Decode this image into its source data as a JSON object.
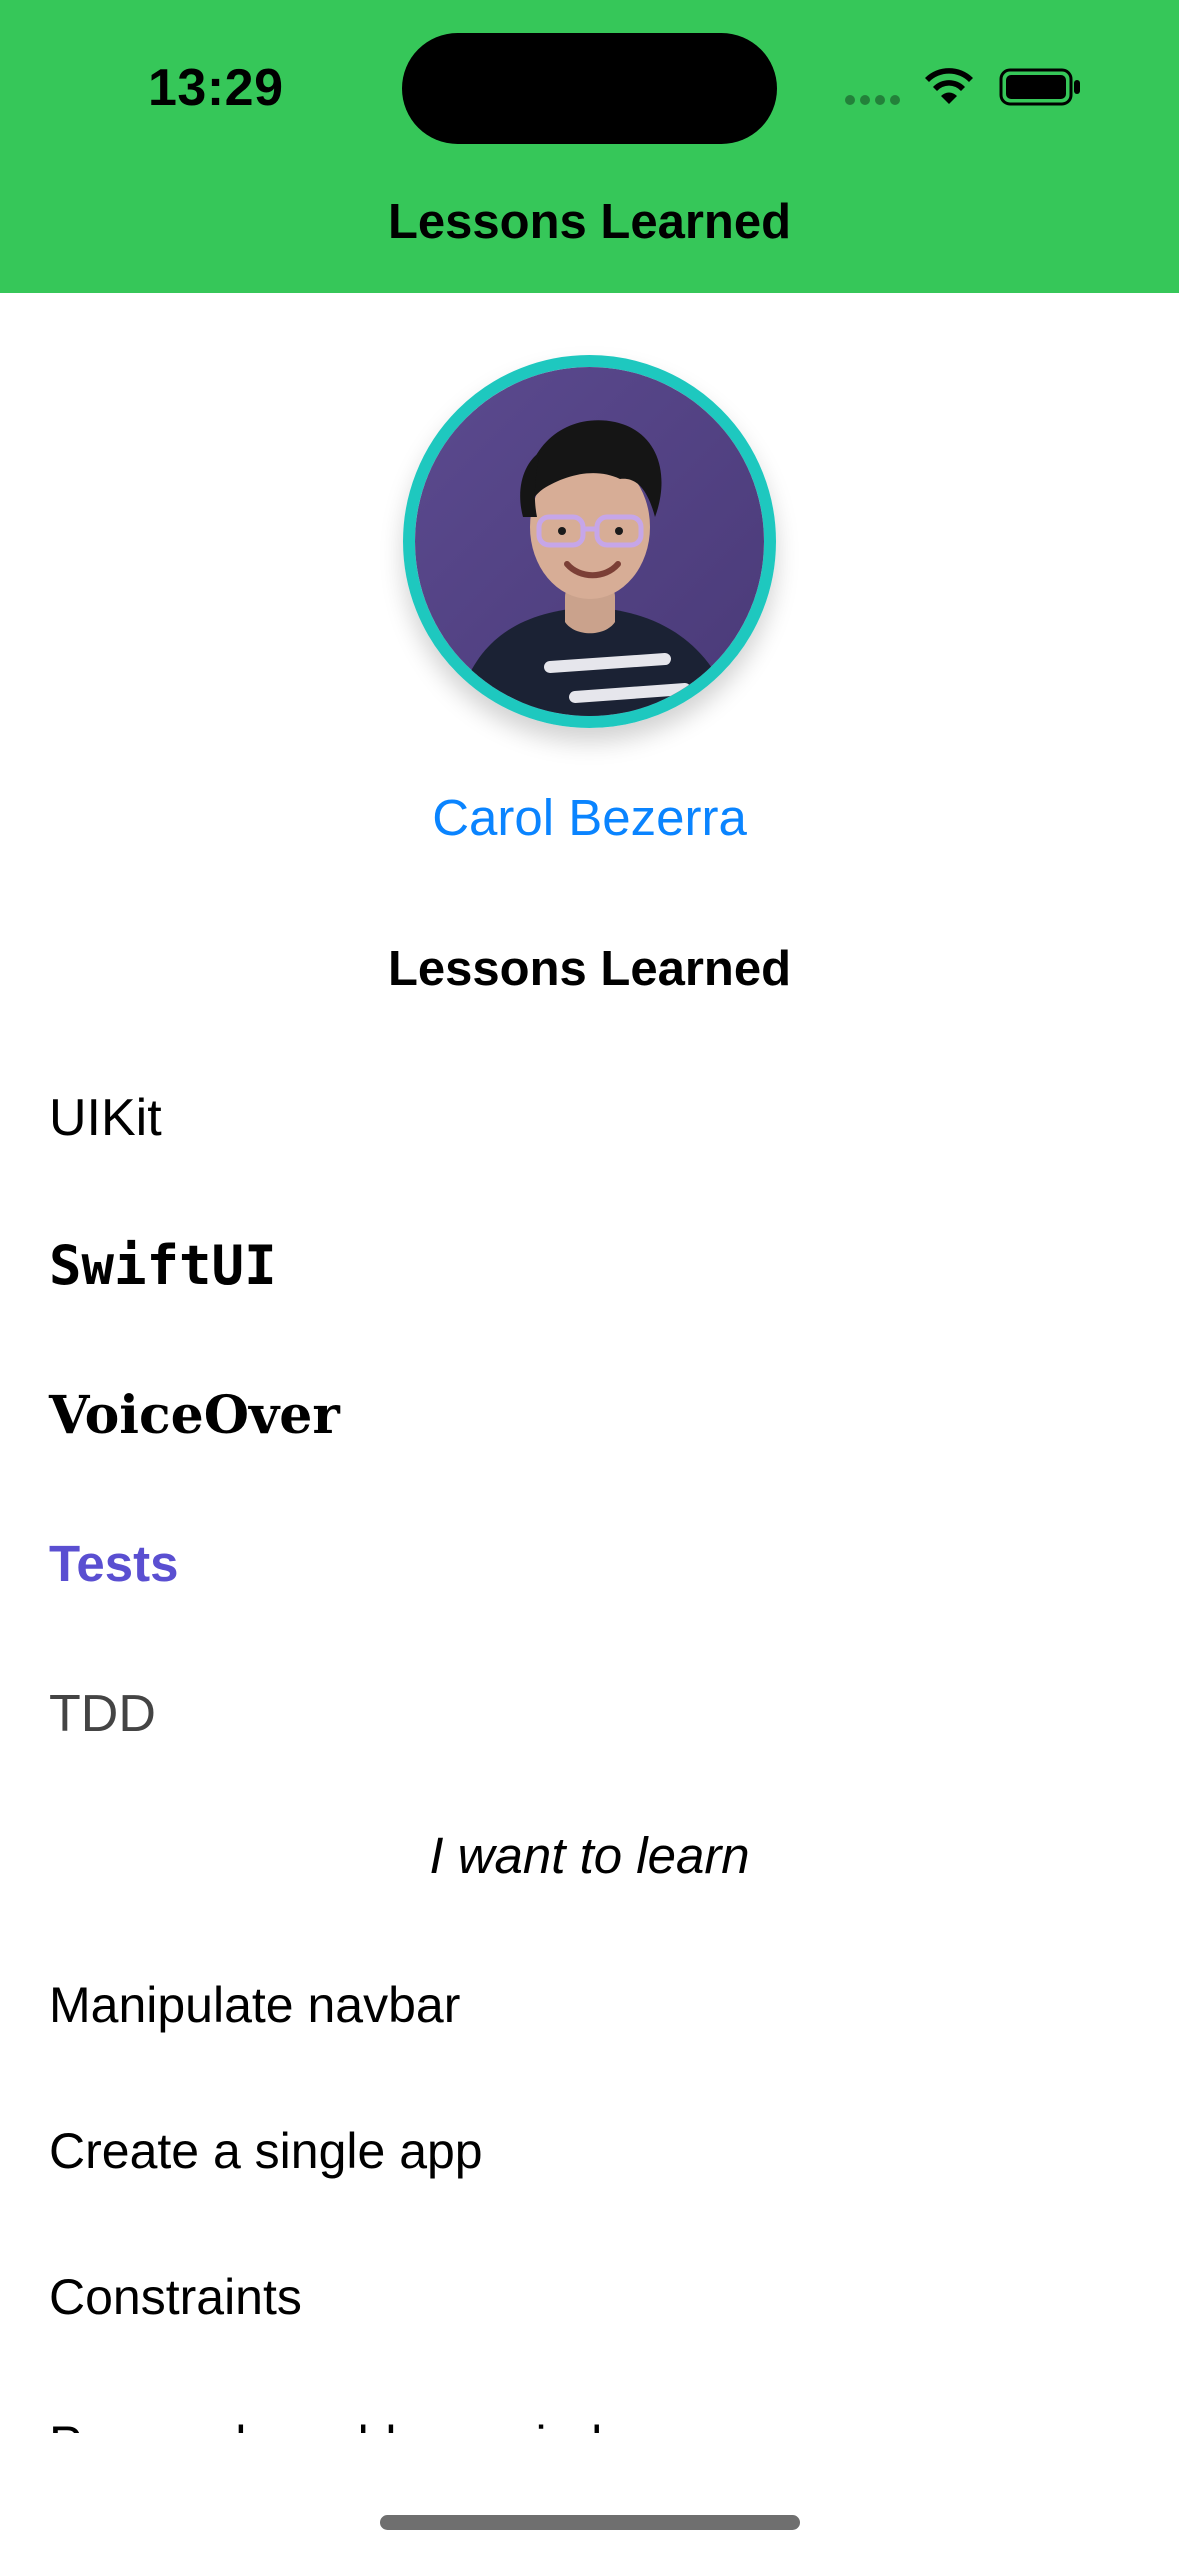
{
  "colors": {
    "header_bg": "#36c759",
    "name_color": "#0a84ff",
    "tests_color": "#5a4fd1",
    "tdd_color": "#444444",
    "home_indicator": "#6f6f6f"
  },
  "status_bar": {
    "time": "13:29",
    "icons": [
      "signal-dots-icon",
      "wifi-icon",
      "battery-icon"
    ]
  },
  "nav": {
    "title": "Lessons Learned"
  },
  "profile": {
    "name": "Carol Bezerra",
    "avatar_icon": "avatar"
  },
  "lessons": {
    "title": "Lessons Learned",
    "items": [
      "UIKit",
      "SwiftUI",
      "VoiceOver",
      "Tests",
      "TDD"
    ]
  },
  "learn": {
    "title": "I want to learn",
    "items": [
      "Manipulate navbar",
      "Create a single app",
      "Constraints",
      "Pensando no blog e ainda"
    ]
  }
}
